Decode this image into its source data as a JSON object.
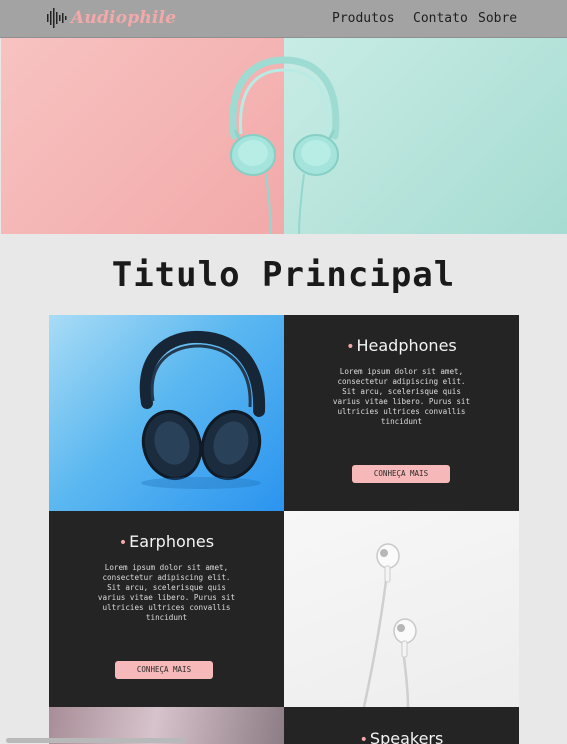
{
  "header": {
    "logo_text": "Audiophile",
    "nav": [
      "Produtos",
      "Contato",
      "Sobre"
    ]
  },
  "hero": {
    "colors": {
      "left": "#f2a9a9",
      "right": "#a6dcd2",
      "headphones": "#a4e4dc"
    }
  },
  "main": {
    "title": "Titulo Principal"
  },
  "products": [
    {
      "title": "Headphones",
      "text": "Lorem ipsum dolor sit amet, consectetur adipiscing elit. Sit arcu, scelerisque quis varius vitae libero. Purus sit ultricies ultrices convallis tincidunt",
      "button": "CONHEÇA MAIS"
    },
    {
      "title": "Earphones",
      "text": "Lorem ipsum dolor sit amet, consectetur adipiscing elit. Sit arcu, scelerisque quis varius vitae libero. Purus sit ultricies ultrices convallis tincidunt",
      "button": "CONHEÇA MAIS"
    },
    {
      "title": "Speakers"
    }
  ],
  "colors": {
    "accent": "#f6b8b8",
    "dark_tile": "#242424",
    "page_bg": "#e8e8e8",
    "header_bg": "#a3a3a3"
  }
}
